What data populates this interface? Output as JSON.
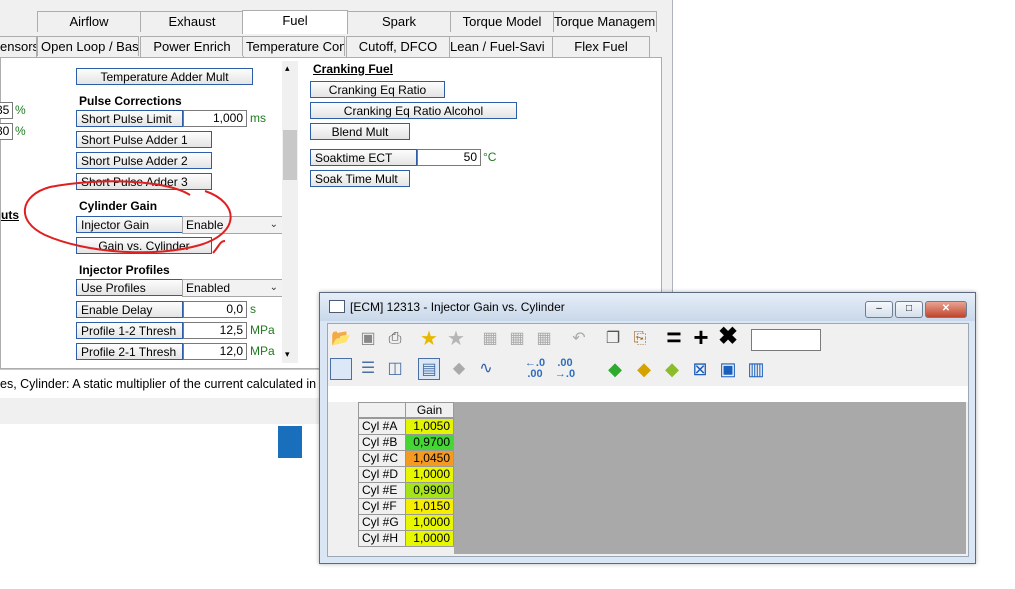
{
  "tabs_row1": [
    {
      "label": "Airflow"
    },
    {
      "label": "Exhaust"
    },
    {
      "label": "Fuel",
      "active": true
    },
    {
      "label": "Spark"
    },
    {
      "label": "Torque Model"
    },
    {
      "label": "Torque Managem"
    }
  ],
  "tabs_row2": [
    {
      "label": "ensors"
    },
    {
      "label": "Open Loop / Bas"
    },
    {
      "label": "Power Enrich"
    },
    {
      "label": "Temperature Con"
    },
    {
      "label": "Cutoff, DFCO"
    },
    {
      "label": "Lean / Fuel-Savi"
    },
    {
      "label": "Flex Fuel"
    }
  ],
  "left_fragments": {
    "val1": "35",
    "unit1": "%",
    "val2": "30",
    "unit2": "%",
    "label": "uts"
  },
  "middle": {
    "temp_adder_mult": "Temperature Adder Mult",
    "pulse_corrections_title": "Pulse Corrections",
    "short_pulse_limit": {
      "label": "Short Pulse Limit",
      "value": "1,000",
      "unit": "ms"
    },
    "short_pulse_adder_1": "Short Pulse Adder 1",
    "short_pulse_adder_2": "Short Pulse Adder 2",
    "short_pulse_adder_3": "Short Pulse Adder 3",
    "cylinder_gain_title": "Cylinder Gain",
    "injector_gain": {
      "label": "Injector Gain",
      "value": "Enable"
    },
    "gain_vs_cylinder": "Gain vs. Cylinder",
    "injector_profiles_title": "Injector Profiles",
    "use_profiles": {
      "label": "Use Profiles",
      "value": "Enabled"
    },
    "enable_delay": {
      "label": "Enable Delay",
      "value": "0,0",
      "unit": "s"
    },
    "profile_12": {
      "label": "Profile 1-2 Thresh",
      "value": "12,5",
      "unit": "MPa"
    },
    "profile_21": {
      "label": "Profile 2-1 Thresh",
      "value": "12,0",
      "unit": "MPa"
    }
  },
  "cranking": {
    "title": "Cranking Fuel",
    "eq_ratio": "Cranking Eq Ratio",
    "eq_ratio_alcohol": "Cranking Eq Ratio Alcohol",
    "blend_mult": "Blend Mult",
    "soaktime_ect": {
      "label": "Soaktime ECT",
      "value": "50",
      "unit": "°C"
    },
    "soak_time_mult": "Soak Time Mult"
  },
  "status_text": "es, Cylinder: A static multiplier of the current calculated in",
  "table_window": {
    "title": "[ECM] 12313 - Injector Gain vs. Cylinder",
    "column_header": "Gain",
    "rows": [
      {
        "label": "Cyl #A",
        "value": "1,0050",
        "color": "#e3f500"
      },
      {
        "label": "Cyl #B",
        "value": "0,9700",
        "color": "#44d633"
      },
      {
        "label": "Cyl #C",
        "value": "1,0450",
        "color": "#f59a20"
      },
      {
        "label": "Cyl #D",
        "value": "1,0000",
        "color": "#e7f700"
      },
      {
        "label": "Cyl #E",
        "value": "0,9900",
        "color": "#a6e41a"
      },
      {
        "label": "Cyl #F",
        "value": "1,0150",
        "color": "#f5ee00"
      },
      {
        "label": "Cyl #G",
        "value": "1,0000",
        "color": "#e7f700"
      },
      {
        "label": "Cyl #H",
        "value": "1,0000",
        "color": "#e7f700"
      }
    ],
    "toolbar_icons": [
      "open-icon",
      "save-icon",
      "print-icon",
      "star-add-icon",
      "star-remove-icon",
      "table-icon-1",
      "table-icon-2",
      "table-icon-3",
      "undo-icon",
      "copy-icon",
      "paste-icon",
      "equals-icon",
      "plus-icon",
      "multiply-icon"
    ],
    "toolbar2_icons": [
      "view-single-icon",
      "view-horizontal-icon",
      "view-vertical-icon",
      "table-view-icon",
      "diamond-icon",
      "line-graph-icon",
      "decimal-decrease-icon",
      "decimal-increase-icon",
      "color-icon-1",
      "color-icon-2",
      "color-icon-3",
      "color-icon-4",
      "color-icon-5",
      "color-icon-6"
    ]
  }
}
